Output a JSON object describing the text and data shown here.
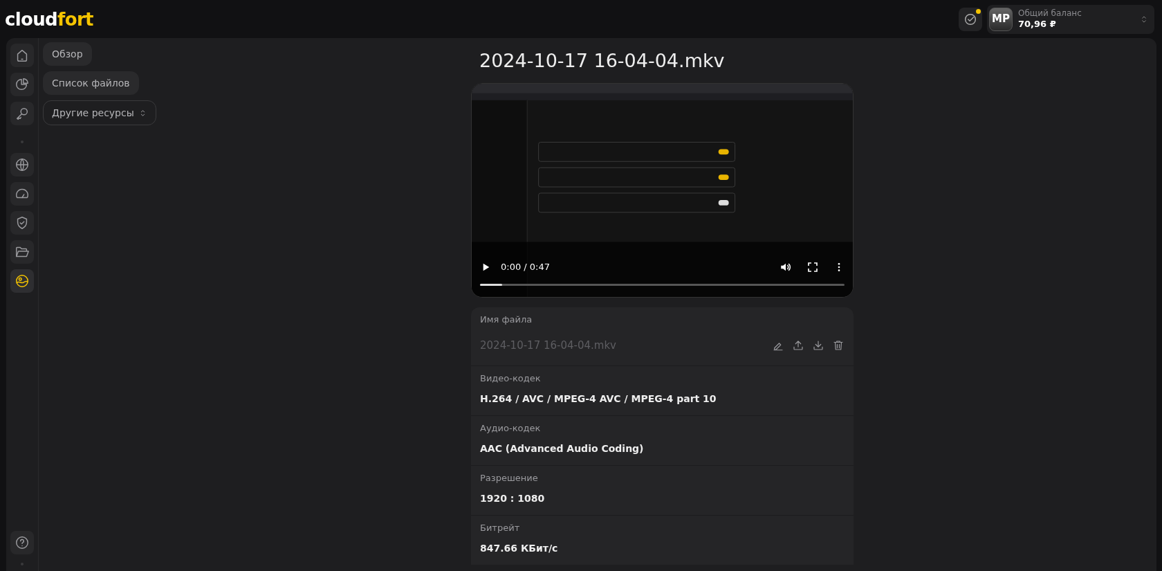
{
  "header": {
    "logo": {
      "part_1": "cloud",
      "part_2": "fort"
    },
    "notifications": {
      "unread": true
    },
    "account": {
      "initials": "MP",
      "label": "Общий баланс",
      "balance": "70,96 ₽"
    }
  },
  "rail": {
    "items": [
      {
        "kind": "button",
        "selected": false
      },
      {
        "kind": "button",
        "selected": false
      },
      {
        "kind": "button",
        "selected": false
      },
      {
        "kind": "separator"
      },
      {
        "kind": "button",
        "selected": false
      },
      {
        "kind": "button",
        "selected": false
      },
      {
        "kind": "button",
        "selected": false
      },
      {
        "kind": "button",
        "selected": false
      },
      {
        "kind": "button",
        "selected": true
      }
    ],
    "bottom": [
      {
        "kind": "button",
        "selected": false
      }
    ]
  },
  "submenu": [
    {
      "label": "Обзор",
      "kind": "button"
    },
    {
      "label": "Список файлов",
      "kind": "button"
    },
    {
      "label": "Другие ресурсы",
      "kind": "dropdown"
    }
  ],
  "title": "2024-10-17 16-04-04.mkv",
  "player": {
    "time": "0:00 / 0:47",
    "level": 0.06
  },
  "details": [
    {
      "label": "Имя файла",
      "value": "2024-10-17 16-04-04.mkv",
      "kind": "editable"
    },
    {
      "label": "Видео-кодек",
      "value": "H.264 / AVC / MPEG-4 AVC / MPEG-4 part 10",
      "kind": "text"
    },
    {
      "label": "Аудио-кодек",
      "value": "AAC (Advanced Audio Coding)",
      "kind": "text"
    },
    {
      "label": "Разрешение",
      "value": "1920 : 1080",
      "kind": "text"
    },
    {
      "label": "Битрейт",
      "value": "847.66 КБит/с",
      "kind": "text"
    }
  ]
}
